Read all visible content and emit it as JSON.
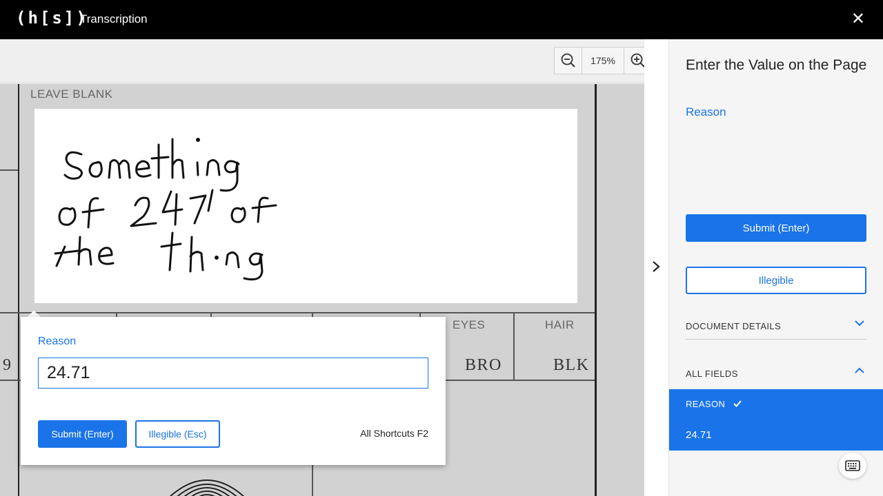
{
  "header": {
    "logo_text": "(h[s])",
    "app_title": "Transcription",
    "close_icon": "close-icon"
  },
  "viewer": {
    "zoom_level": "175%",
    "zoom_out_icon": "zoom-out-icon",
    "zoom_in_icon": "zoom-in-icon"
  },
  "document": {
    "leave_blank_label": "LEAVE BLANK",
    "eyes_label": "EYES",
    "hair_label": "HAIR",
    "eyes_value": "BRO",
    "hair_value": "BLK",
    "left_edge_digit": "9",
    "handwriting_lines": [
      "something",
      "of 24.71 of",
      "the thing"
    ]
  },
  "popup": {
    "field_label": "Reason",
    "input_value": "24.71",
    "submit_label": "Submit (Enter)",
    "illegible_label": "Illegible (Esc)",
    "shortcuts_text": "All Shortcuts F2"
  },
  "sidebar": {
    "title": "Enter the Value on the Page",
    "field_name": "Reason",
    "submit_label": "Submit (Enter)",
    "illegible_label": "Illegible",
    "sections": {
      "document_details": "DOCUMENT DETAILS",
      "all_fields": "ALL FIELDS"
    },
    "fields": [
      {
        "name": "REASON",
        "value": "24.71",
        "completed": true
      }
    ],
    "keyboard_icon": "keyboard-icon"
  },
  "colors": {
    "accent": "#1a73e8",
    "topbar": "#000000"
  }
}
